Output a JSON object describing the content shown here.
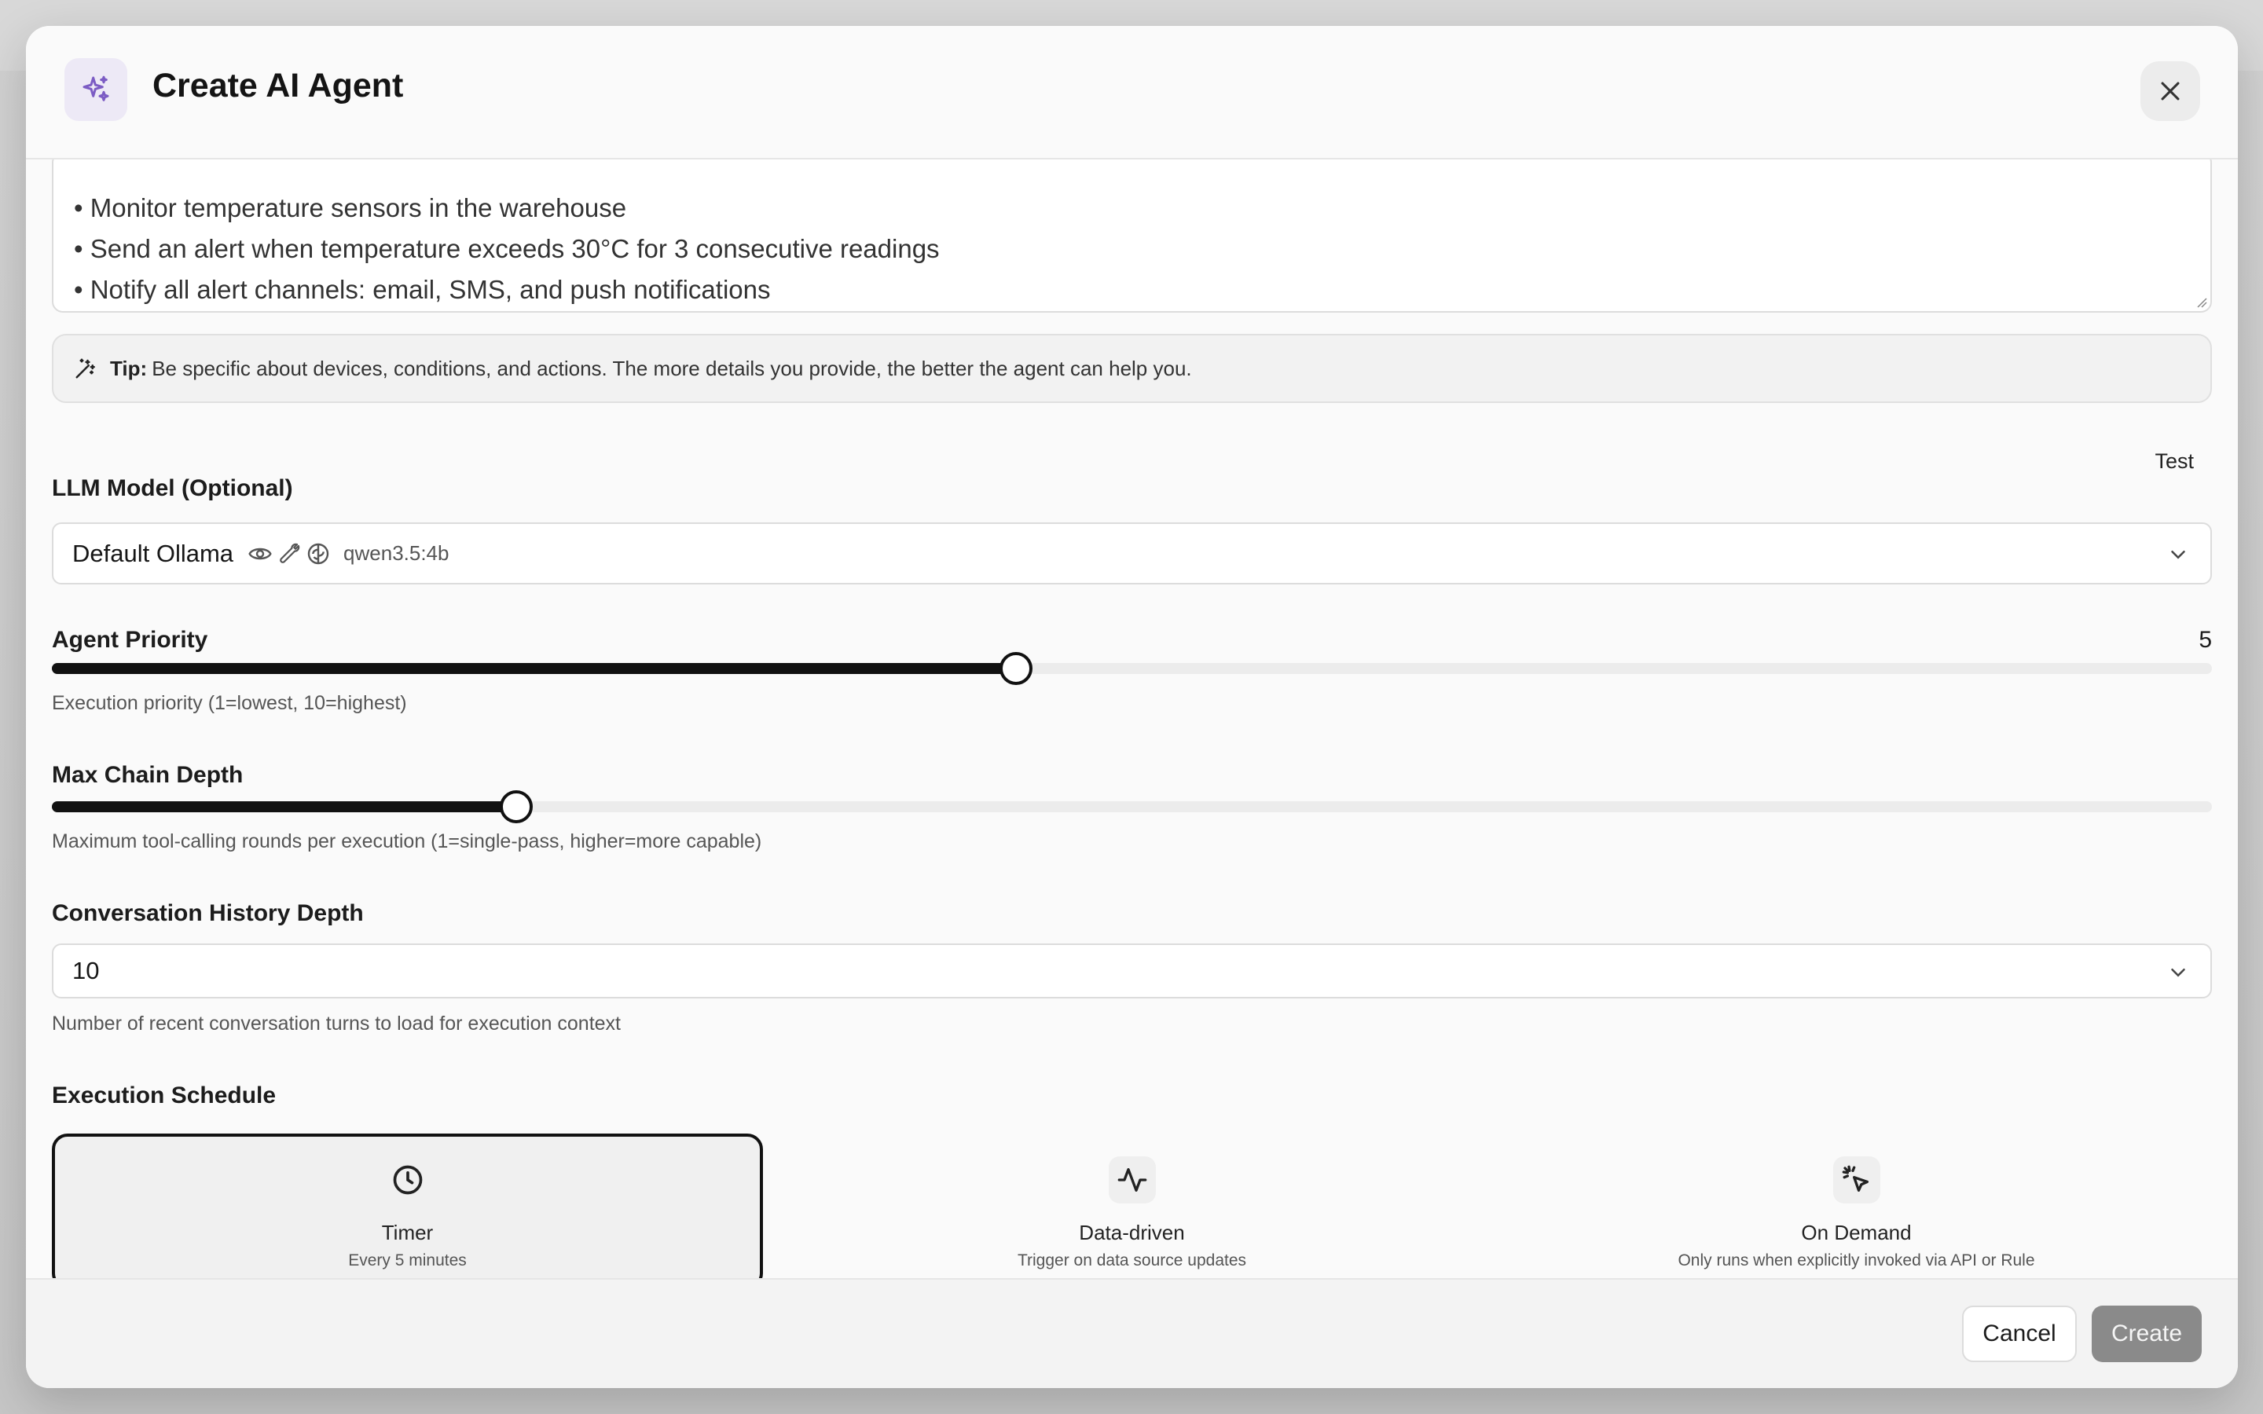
{
  "dialog": {
    "title": "Create AI Agent",
    "close_label": "close"
  },
  "description": {
    "lines": [
      "• Monitor temperature sensors in the warehouse",
      "• Send an alert when temperature exceeds 30°C for 3 consecutive readings",
      "• Notify all alert channels: email, SMS, and push notifications"
    ]
  },
  "tip": {
    "label": "Tip:",
    "text": "Be specific about devices, conditions, and actions. The more details you provide, the better the agent can help you."
  },
  "llm_model": {
    "label": "LLM Model (Optional)",
    "test_label": "Test",
    "selected_name": "Default Ollama",
    "capability_icons": [
      "eye-icon",
      "wrench-icon",
      "brain-icon"
    ],
    "model_id": "qwen3.5:4b"
  },
  "agent_priority": {
    "label": "Agent Priority",
    "value": "5",
    "min": 1,
    "max": 10,
    "hint": "Execution priority (1=lowest, 10=highest)"
  },
  "max_chain_depth": {
    "label": "Max Chain Depth",
    "fill_fraction": 0.215,
    "hint": "Maximum tool-calling rounds per execution (1=single-pass, higher=more capable)"
  },
  "history_depth": {
    "label": "Conversation History Depth",
    "value": "10",
    "hint": "Number of recent conversation turns to load for execution context"
  },
  "schedule": {
    "label": "Execution Schedule",
    "options": [
      {
        "title": "Timer",
        "subtitle": "Every 5 minutes",
        "icon": "clock-icon",
        "selected": true
      },
      {
        "title": "Data-driven",
        "subtitle": "Trigger on data source updates",
        "icon": "activity-icon",
        "selected": false
      },
      {
        "title": "On Demand",
        "subtitle": "Only runs when explicitly invoked via API or Rule",
        "icon": "pointer-click-icon",
        "selected": false
      }
    ]
  },
  "footer": {
    "cancel_label": "Cancel",
    "create_label": "Create"
  },
  "colors": {
    "accent_icon": "#7c5cc4",
    "primary": "#111111",
    "disabled_button": "#8a8a8a"
  }
}
